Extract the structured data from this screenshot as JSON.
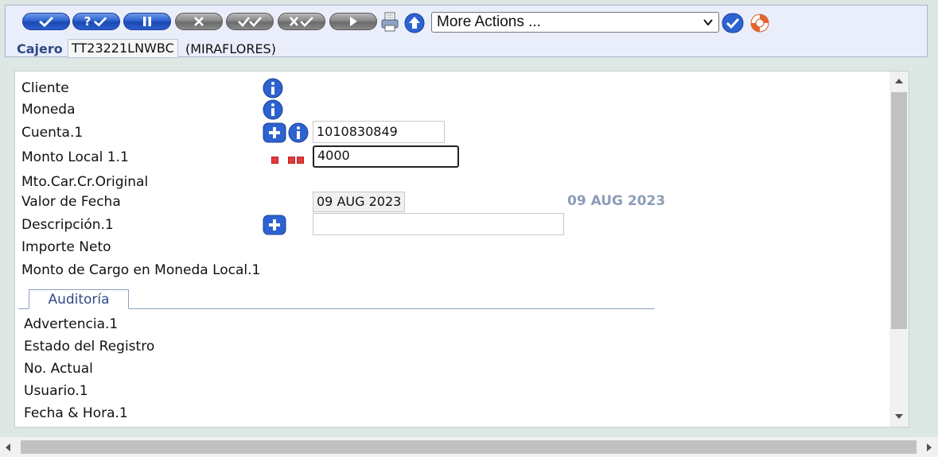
{
  "toolbar": {
    "buttons": [
      {
        "name": "commit-button",
        "icon": "check-icon",
        "color": "blue"
      },
      {
        "name": "validate-button",
        "icon": "question-check-icon",
        "color": "blue",
        "glyph": "?"
      },
      {
        "name": "hold-button",
        "icon": "pause-icon",
        "color": "blue"
      },
      {
        "name": "delete-button",
        "icon": "x-icon",
        "color": "gray"
      },
      {
        "name": "authorise-button",
        "icon": "double-check-icon",
        "color": "gray"
      },
      {
        "name": "reverse-button",
        "icon": "x-check-icon",
        "color": "gray"
      },
      {
        "name": "next-button",
        "icon": "play-icon",
        "color": "gray"
      }
    ],
    "actions_select": "More Actions ...",
    "cajero_label": "Cajero",
    "cajero_value": "TT23221LNWBC",
    "cajero_branch": "(MIRAFLORES)"
  },
  "form": {
    "cliente_label": "Cliente",
    "moneda_label": "Moneda",
    "cuenta_label": "Cuenta.1",
    "cuenta_value": "1010830849",
    "monto_label": "Monto Local 1.1",
    "monto_value": "4000",
    "mto_car_label": "Mto.Car.Cr.Original",
    "valor_fecha_label": "Valor de Fecha",
    "valor_fecha_value": "09 AUG 2023",
    "valor_fecha_display": "09 AUG 2023",
    "descripcion_label": "Descripción.1",
    "descripcion_value": "",
    "importe_label": "Importe Neto",
    "monto_cargo_label": "Monto de Cargo en Moneda Local.1"
  },
  "audit": {
    "tab_label": "Auditoría",
    "advertencia_label": "Advertencia.1",
    "estado_label": "Estado del Registro",
    "no_actual_label": "No. Actual",
    "usuario_label": "Usuario.1",
    "fecha_hora_label": "Fecha & Hora.1"
  },
  "colors": {
    "accent_blue": "#2d63d0",
    "label_blue": "#2f4a86",
    "date_gray": "#8d9db8",
    "error_red": "#e23b3b"
  }
}
